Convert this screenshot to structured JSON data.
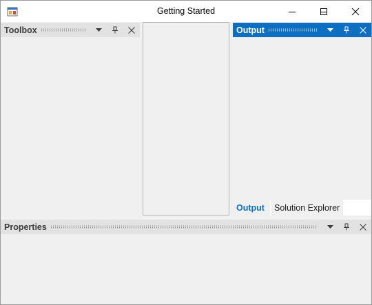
{
  "window": {
    "title": "Getting Started",
    "icon": "app-icon",
    "controls": [
      "minimize-icon",
      "maximize-icon",
      "close-icon"
    ]
  },
  "toolbox": {
    "title": "Toolbox",
    "active": false,
    "buttons": [
      "dropdown-arrow-icon",
      "pin-icon",
      "close-icon"
    ]
  },
  "output": {
    "title": "Output",
    "active": true,
    "buttons": [
      "dropdown-arrow-icon",
      "pin-icon",
      "close-icon"
    ],
    "tabs": [
      {
        "label": "Output",
        "selected": true
      },
      {
        "label": "Solution Explorer",
        "selected": false
      }
    ]
  },
  "properties": {
    "title": "Properties",
    "active": false,
    "buttons": [
      "dropdown-arrow-icon",
      "pin-icon",
      "close-icon"
    ]
  },
  "colors": {
    "accent": "#0d6fc2",
    "inactive_header": "#e2e2e2",
    "background": "#f0f0f0"
  }
}
